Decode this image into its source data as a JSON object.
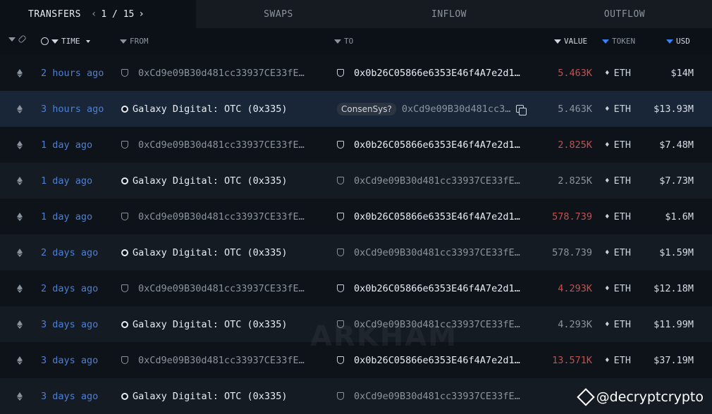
{
  "tabs": {
    "transfers": "TRANSFERS",
    "page": "1 / 15",
    "swaps": "SWAPS",
    "inflow": "INFLOW",
    "outflow": "OUTFLOW"
  },
  "header": {
    "time": "TIME",
    "from": "FROM",
    "to": "TO",
    "value": "VALUE",
    "token": "TOKEN",
    "usd": "USD"
  },
  "rows": [
    {
      "time": "2 hours ago",
      "from": "0xCd9e09B30d481cc33937CE33fE…",
      "to": "0x0b26C05866e6353E46f4A7e2d1…",
      "value": "5.463K",
      "token": "ETH",
      "usd": "$14M"
    },
    {
      "time": "3 hours ago",
      "from": "Galaxy Digital: OTC (0x335)",
      "to_chip": "ConsenSys?",
      "to": "0xCd9e09B30d481cc3…",
      "value": "5.463K",
      "token": "ETH",
      "usd": "$13.93M"
    },
    {
      "time": "1 day ago",
      "from": "0xCd9e09B30d481cc33937CE33fE…",
      "to": "0x0b26C05866e6353E46f4A7e2d1…",
      "value": "2.825K",
      "token": "ETH",
      "usd": "$7.48M"
    },
    {
      "time": "1 day ago",
      "from": "Galaxy Digital: OTC (0x335)",
      "to": "0xCd9e09B30d481cc33937CE33fE…",
      "value": "2.825K",
      "token": "ETH",
      "usd": "$7.73M"
    },
    {
      "time": "1 day ago",
      "from": "0xCd9e09B30d481cc33937CE33fE…",
      "to": "0x0b26C05866e6353E46f4A7e2d1…",
      "value": "578.739",
      "token": "ETH",
      "usd": "$1.6M"
    },
    {
      "time": "2 days ago",
      "from": "Galaxy Digital: OTC (0x335)",
      "to": "0xCd9e09B30d481cc33937CE33fE…",
      "value": "578.739",
      "token": "ETH",
      "usd": "$1.59M"
    },
    {
      "time": "2 days ago",
      "from": "0xCd9e09B30d481cc33937CE33fE…",
      "to": "0x0b26C05866e6353E46f4A7e2d1…",
      "value": "4.293K",
      "token": "ETH",
      "usd": "$12.18M"
    },
    {
      "time": "3 days ago",
      "from": "Galaxy Digital: OTC (0x335)",
      "to": "0xCd9e09B30d481cc33937CE33fE…",
      "value": "4.293K",
      "token": "ETH",
      "usd": "$11.99M"
    },
    {
      "time": "3 days ago",
      "from": "0xCd9e09B30d481cc33937CE33fE…",
      "to": "0x0b26C05866e6353E46f4A7e2d1…",
      "value": "13.571K",
      "token": "ETH",
      "usd": "$37.19M"
    },
    {
      "time": "3 days ago",
      "from": "Galaxy Digital: OTC (0x335)",
      "to": "0xCd9e09B30d481cc33937CE33fE…",
      "value": "",
      "token": "",
      "usd": ""
    }
  ],
  "watermark": {
    "center": "ARKHAM",
    "corner": "@decryptcrypto"
  },
  "colors": {
    "background": "#0c1117",
    "time_blue": "#4f7fd0",
    "value_red": "#c2514f",
    "highlight_row": "#192638"
  }
}
